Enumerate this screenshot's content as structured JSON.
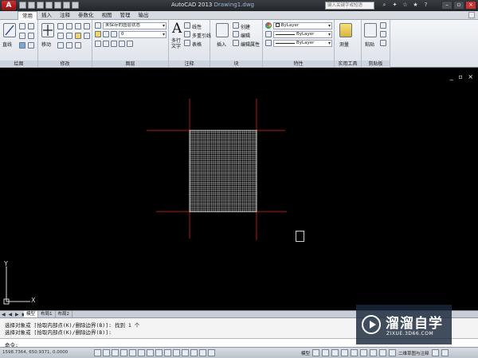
{
  "titlebar": {
    "logo": "A",
    "app_title": "AutoCAD 2013",
    "document": "Drawing1.dwg",
    "search_placeholder": "键入关键字或短语"
  },
  "tabs": [
    "常用",
    "插入",
    "注释",
    "参数化",
    "视图",
    "管理",
    "输出"
  ],
  "ribbon": {
    "draw": {
      "title": "绘图",
      "big_label": "直线"
    },
    "modify": {
      "title": "修改",
      "move_label": "移动"
    },
    "layers": {
      "title": "图层",
      "state_combo": "未保存的图层状态",
      "layer_combo": "0"
    },
    "annotation": {
      "title": "注释",
      "mtext_label": "多行\n文字",
      "linear": "线性",
      "multileader": "多重引线",
      "table": "表格"
    },
    "block": {
      "title": "块",
      "insert_label": "插入",
      "create": "创建",
      "edit": "编辑",
      "edit_attr": "编辑属性"
    },
    "properties": {
      "title": "特性",
      "color": "ByLayer",
      "linetype": "ByLayer",
      "lineweight": "ByLayer"
    },
    "utilities": {
      "title": "实用工具",
      "measure": "测量"
    },
    "clipboard": {
      "title": "剪贴板",
      "paste": "粘贴"
    }
  },
  "viewport": {
    "controls": "_ ▫ ×",
    "ucs_x": "X",
    "ucs_y": "Y"
  },
  "layout": {
    "nav": "◀ ◀ ▶ ▶",
    "tabs": [
      "模型",
      "布局1",
      "布局2"
    ]
  },
  "command": {
    "history": [
      "选择对象或 [拾取内部点(K)/删除边界(B)]: 找到 1 个",
      "选择对象或 [拾取内部点(K)/删除边界(B)]:"
    ],
    "prompt": "命令:"
  },
  "status": {
    "coords": "1598.7364, 650.9371, 0.0000",
    "model": "模型",
    "workspace": "二维草图与注释"
  },
  "watermark": {
    "title": "溜溜自学",
    "url": "ZIXUE.3D66.COM"
  }
}
